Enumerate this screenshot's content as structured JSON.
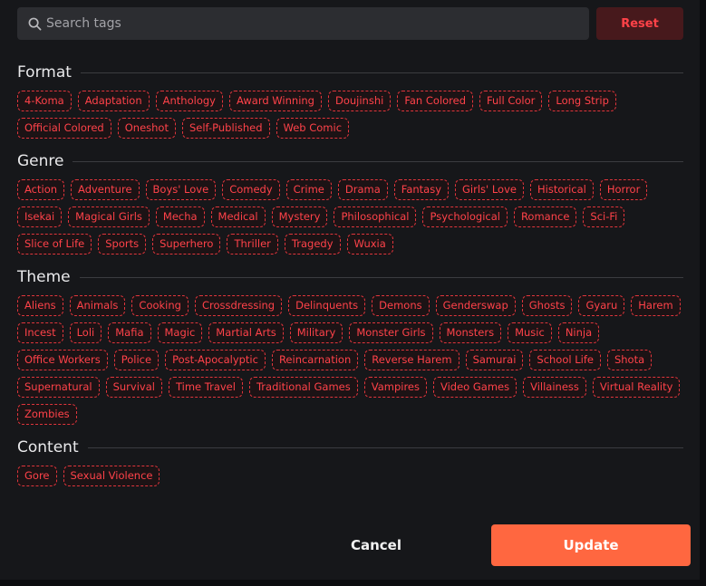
{
  "search": {
    "placeholder": "Search tags",
    "value": ""
  },
  "reset_label": "Reset",
  "sections": [
    {
      "title": "Format",
      "tags": [
        "4-Koma",
        "Adaptation",
        "Anthology",
        "Award Winning",
        "Doujinshi",
        "Fan Colored",
        "Full Color",
        "Long Strip",
        "Official Colored",
        "Oneshot",
        "Self-Published",
        "Web Comic"
      ]
    },
    {
      "title": "Genre",
      "tags": [
        "Action",
        "Adventure",
        "Boys' Love",
        "Comedy",
        "Crime",
        "Drama",
        "Fantasy",
        "Girls' Love",
        "Historical",
        "Horror",
        "Isekai",
        "Magical Girls",
        "Mecha",
        "Medical",
        "Mystery",
        "Philosophical",
        "Psychological",
        "Romance",
        "Sci-Fi",
        "Slice of Life",
        "Sports",
        "Superhero",
        "Thriller",
        "Tragedy",
        "Wuxia"
      ]
    },
    {
      "title": "Theme",
      "tags": [
        "Aliens",
        "Animals",
        "Cooking",
        "Crossdressing",
        "Delinquents",
        "Demons",
        "Genderswap",
        "Ghosts",
        "Gyaru",
        "Harem",
        "Incest",
        "Loli",
        "Mafia",
        "Magic",
        "Martial Arts",
        "Military",
        "Monster Girls",
        "Monsters",
        "Music",
        "Ninja",
        "Office Workers",
        "Police",
        "Post-Apocalyptic",
        "Reincarnation",
        "Reverse Harem",
        "Samurai",
        "School Life",
        "Shota",
        "Supernatural",
        "Survival",
        "Time Travel",
        "Traditional Games",
        "Vampires",
        "Video Games",
        "Villainess",
        "Virtual Reality",
        "Zombies"
      ]
    },
    {
      "title": "Content",
      "tags": [
        "Gore",
        "Sexual Violence"
      ]
    }
  ],
  "footer": {
    "cancel_label": "Cancel",
    "update_label": "Update"
  },
  "colors": {
    "accent": "#ff6740",
    "tag_red": "#ff4249",
    "reset_bg": "#47191c"
  },
  "icons": {
    "search": "search-icon"
  }
}
